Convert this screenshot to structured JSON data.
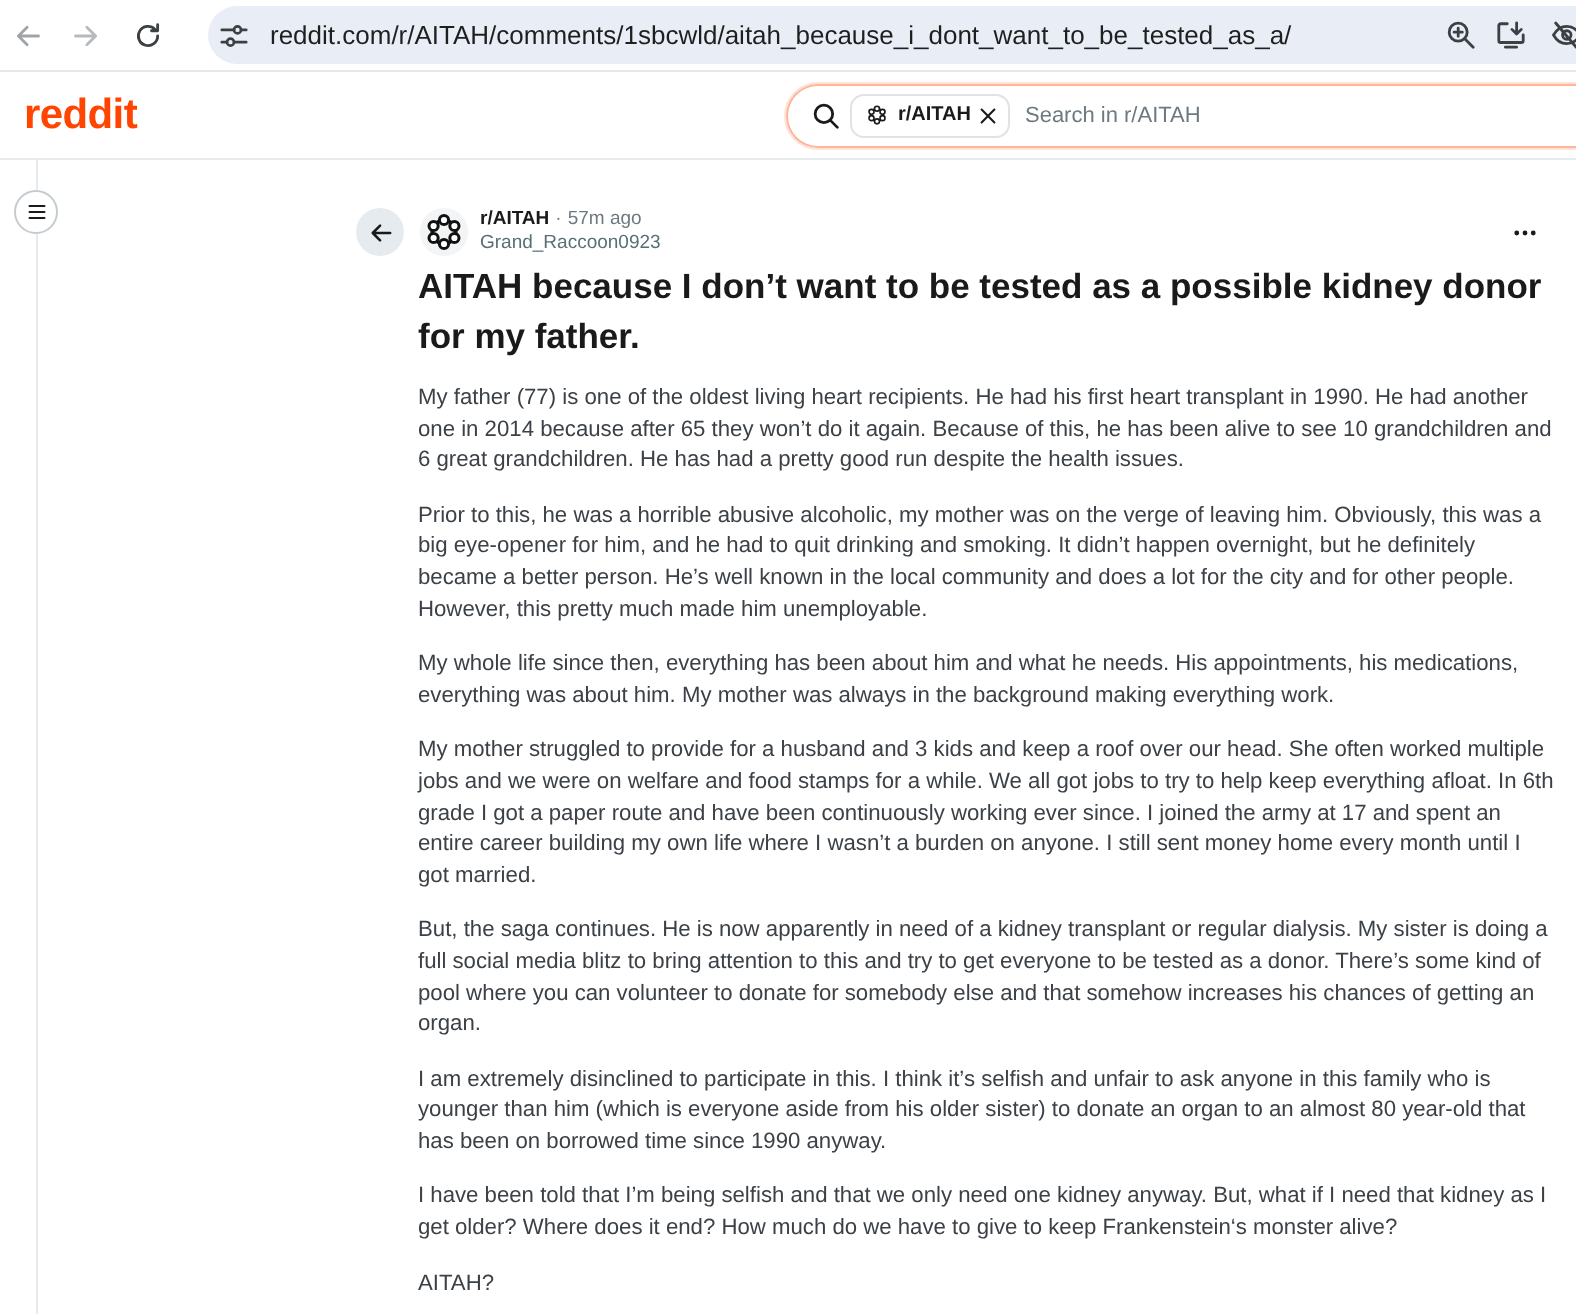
{
  "browser": {
    "address_bar": {
      "url": "reddit.com/r/AITAH/comments/1sbcwld/aitah_because_i_dont_want_to_be_tested_as_a/"
    }
  },
  "header": {
    "logo": "reddit",
    "search": {
      "community_chip": "r/AITAH",
      "placeholder": "Search in r/AITAH"
    }
  },
  "post": {
    "subreddit": "r/AITAH",
    "separator": "·",
    "time": "57m ago",
    "author": "Grand_Raccoon0923",
    "title": "AITAH because I don’t want to be tested as a possible kidney donor for my father.",
    "paragraphs": [
      "My father (77) is one of the oldest living heart recipients. He had his first heart transplant in 1990. He had another one in 2014 because after 65 they won’t do it again. Because of this, he has been alive to see 10 grandchildren and 6 great grandchildren. He has had a pretty good run despite the health issues.",
      "Prior to this, he was a horrible abusive alcoholic, my mother was on the verge of leaving him. Obviously, this was a big eye-opener for him, and he had to quit drinking and smoking. It didn’t happen overnight, but he definitely became a better person. He’s well known in the local community and does a lot for the city and for other people. However, this pretty much made him unemployable.",
      "My whole life since then, everything has been about him and what he needs. His appointments, his medications, everything was about him. My mother was always in the background making everything work.",
      "My mother struggled to provide for a husband and 3 kids and keep a roof over our head. She often worked multiple jobs and we were on welfare and food stamps for a while. We all got jobs to try to help keep everything afloat. In 6th grade I got a paper route and have been continuously working ever since. I joined the army at 17 and spent an entire career building my own life where I wasn’t a burden on anyone. I still sent money home every month until I got married.",
      "But, the saga continues. He is now apparently in need of a kidney transplant or regular dialysis. My sister is doing a full social media blitz to bring attention to this and try to get everyone to be tested as a donor. There’s some kind of pool where you can volunteer to donate for somebody else and that somehow increases his chances of getting an organ.",
      "I am extremely disinclined to participate in this. I think it’s selfish and unfair to ask anyone in this family who is younger than him (which is everyone aside from his older sister) to donate an organ to an almost 80 year-old that has been on borrowed time since 1990 anyway.",
      "I have been told that I’m being selfish and that we only need one kidney anyway. But, what if I need that kidney as I get older? Where does it end? How much do we have to give to keep Frankenstein‘s monster alive?",
      "AITAH?"
    ]
  }
}
